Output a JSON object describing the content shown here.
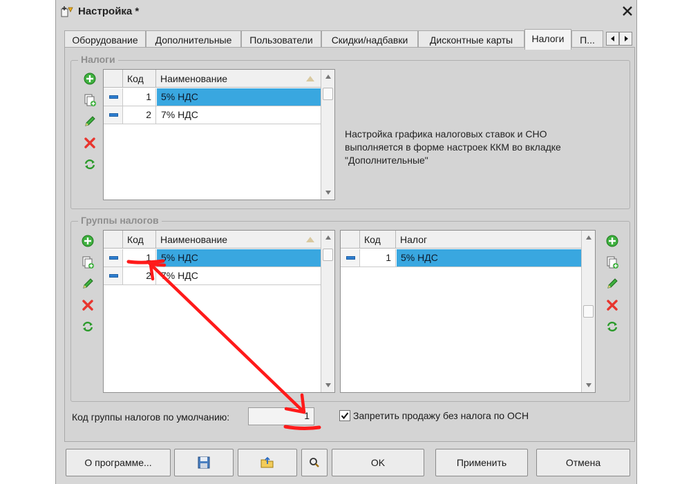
{
  "window": {
    "title": "Настройка *"
  },
  "tabs": [
    {
      "label": "Оборудование"
    },
    {
      "label": "Дополнительные"
    },
    {
      "label": "Пользователи"
    },
    {
      "label": "Скидки/надбавки"
    },
    {
      "label": "Дисконтные карты"
    },
    {
      "label": "Налоги",
      "active": true
    },
    {
      "label": "П..."
    }
  ],
  "taxes": {
    "legend": "Налоги",
    "columns": {
      "code": "Код",
      "name": "Наименование"
    },
    "rows": [
      {
        "code": "1",
        "name": "5% НДС",
        "selected": true
      },
      {
        "code": "2",
        "name": "7% НДС",
        "selected": false
      }
    ],
    "info_lines": [
      "Настройка графика налоговых ставок и СНО",
      "выполняется в форме настроек ККМ во вкладке",
      "\"Дополнительные\""
    ]
  },
  "tax_groups": {
    "legend": "Группы налогов",
    "columns": {
      "code": "Код",
      "name": "Наименование"
    },
    "rows": [
      {
        "code": "1",
        "name": "5% НДС",
        "selected": true
      },
      {
        "code": "2",
        "name": "7% НДС",
        "selected": false
      }
    ],
    "detail_columns": {
      "code": "Код",
      "tax": "Налог"
    },
    "detail_rows": [
      {
        "code": "1",
        "tax": "5% НДС",
        "selected": true
      }
    ]
  },
  "default_group": {
    "label": "Код группы налогов по умолчанию:",
    "value": "1"
  },
  "forbid_no_tax": {
    "label": "Запретить продажу без налога по ОСН",
    "checked": true
  },
  "buttons": {
    "about": "О программе...",
    "ok": "OK",
    "apply": "Применить",
    "cancel": "Отмена"
  },
  "icons": [
    "settings-icon",
    "close-icon",
    "add-icon",
    "copy-icon",
    "edit-icon",
    "delete-icon",
    "refresh-icon",
    "save-icon",
    "open-folder-icon",
    "search-icon"
  ],
  "colors": {
    "selection": "#39a7e0",
    "annotation": "#ff1a1a",
    "window_bg": "#d7d7d7"
  }
}
